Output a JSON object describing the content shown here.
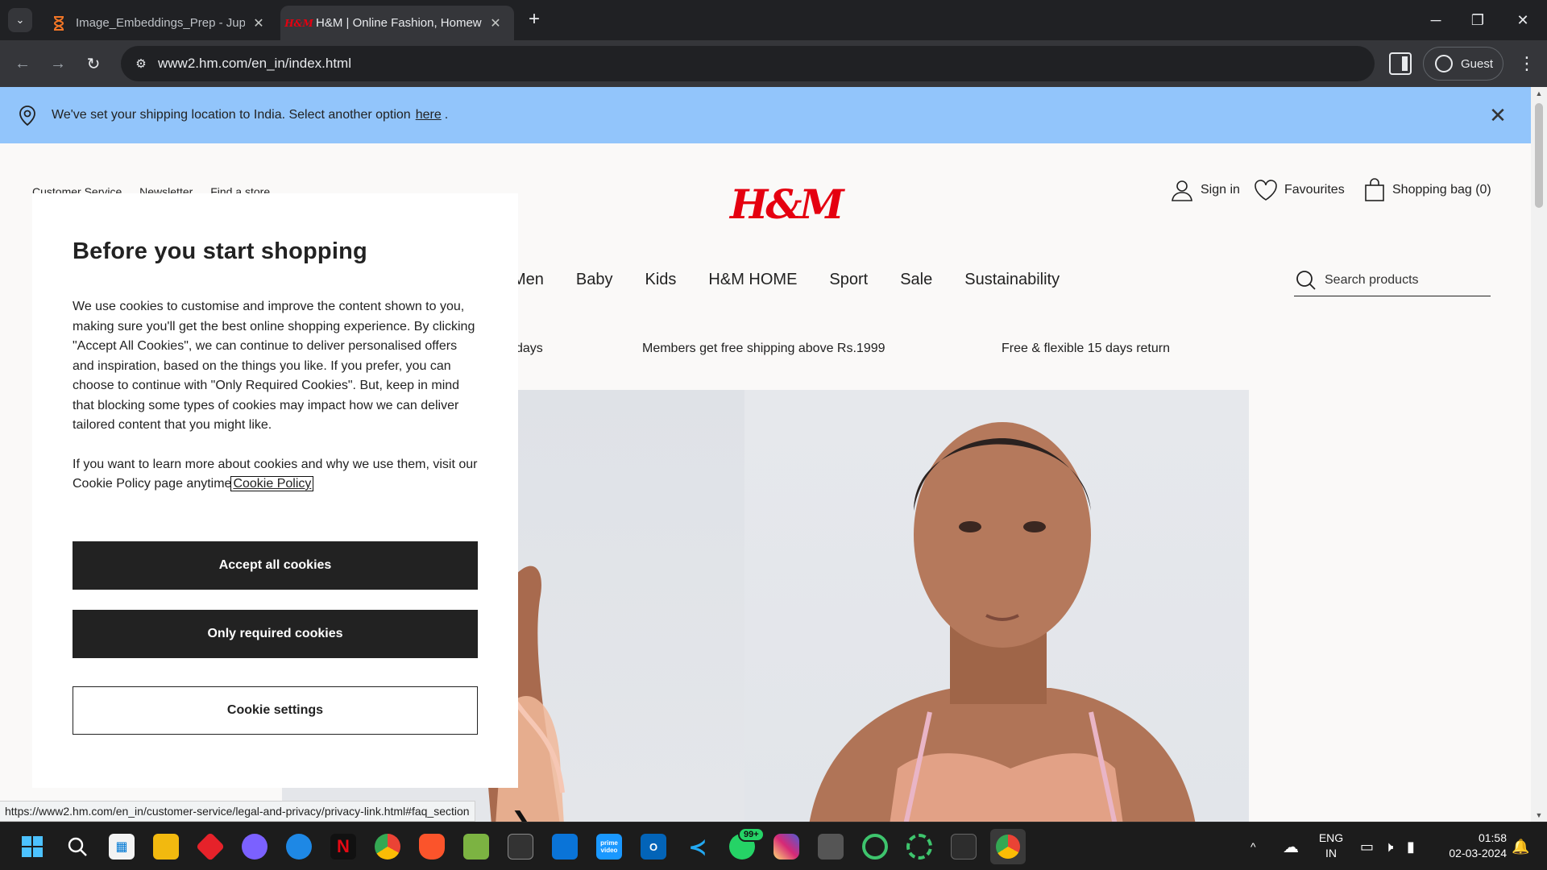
{
  "browser": {
    "tabs": [
      {
        "title": "Image_Embeddings_Prep - Jupyter",
        "icon": "hourglass-icon",
        "active": false
      },
      {
        "title": "H&M | Online Fashion, Homeware",
        "icon": "hm-favicon-icon",
        "active": true
      }
    ],
    "url": "www2.hm.com/en_in/index.html",
    "profile_label": "Guest",
    "status_url": "https://www2.hm.com/en_in/customer-service/legal-and-privacy/privacy-link.html#faq_section"
  },
  "banner": {
    "text": "We've set your shipping location to India. Select another option",
    "link": "here",
    "suffix": ".",
    "bg_color": "#92c5fb"
  },
  "header": {
    "top_links": [
      "Customer Service",
      "Newsletter",
      "Find a store",
      "..."
    ],
    "logo_text": "H&M",
    "logo_color": "#e50010",
    "sign_in": "Sign in",
    "favourites": "Favourites",
    "shopping_bag": "Shopping bag (0)"
  },
  "nav": {
    "items": [
      "Men",
      "Baby",
      "Kids",
      "H&M HOME",
      "Sport",
      "Sale",
      "Sustainability"
    ],
    "search_placeholder": "Search products"
  },
  "promos": [
    "days",
    "Members get free shipping above Rs.1999",
    "Free & flexible 15 days return"
  ],
  "cookie_modal": {
    "title": "Before you start shopping",
    "body1": "We use cookies to customise and improve the content shown to you, making sure you'll get the best online shopping experience. By clicking \"Accept All Cookies\", we can continue to deliver personalised offers and inspiration, based on the things you like. If you prefer, you can choose to continue with \"Only Required Cookies\". But, keep in mind that blocking some types of cookies may impact how we can deliver tailored content that you might like.",
    "body2": "If you want to learn more about cookies and why we use them, visit our Cookie Policy page anytime",
    "policy_link": "Cookie Policy",
    "accept_all": "Accept all cookies",
    "only_required": "Only required cookies",
    "settings": "Cookie settings"
  },
  "taskbar": {
    "apps": [
      "start",
      "search",
      "store",
      "file-explorer",
      "red-app",
      "copilot",
      "edge",
      "netflix",
      "chrome",
      "brave",
      "notepad",
      "terminal-dark",
      "store-blue",
      "prime-video",
      "outlook",
      "vscode",
      "whatsapp",
      "instagram",
      "keyboard-app",
      "green-ring-1",
      "green-ring-2",
      "powershell",
      "chrome-active"
    ],
    "whatsapp_badge": "99+",
    "prime_label": "prime video",
    "lang_line1": "ENG",
    "lang_line2": "IN",
    "time": "01:58",
    "date": "02-03-2024"
  }
}
